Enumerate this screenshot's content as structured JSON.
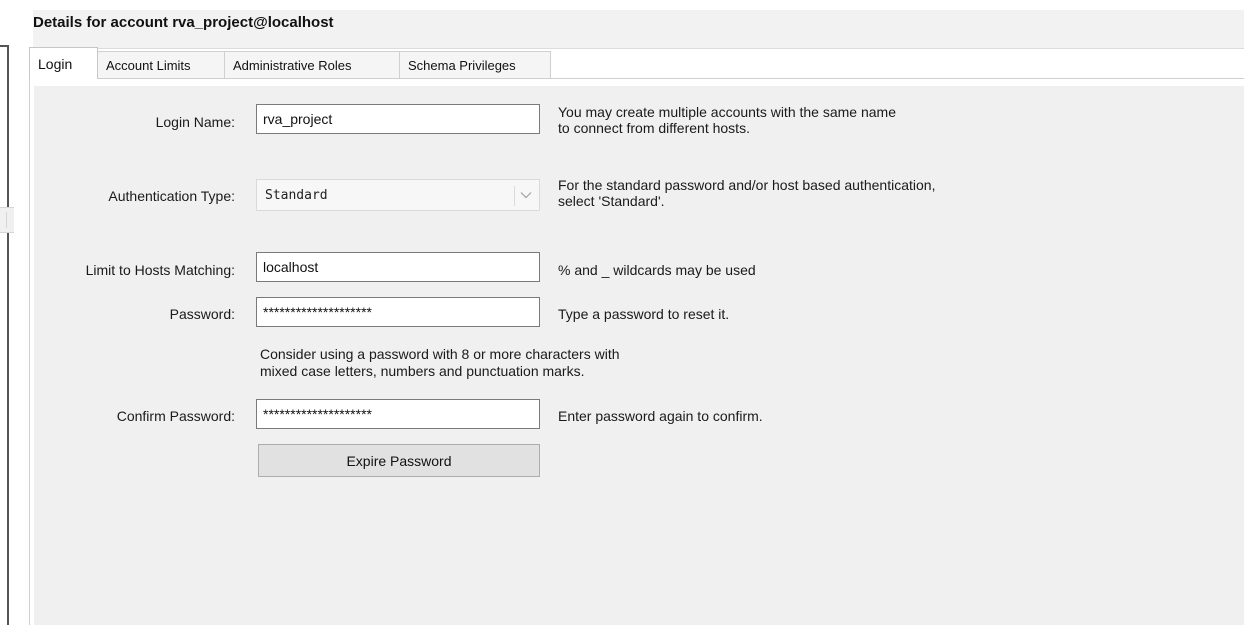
{
  "header": {
    "title": "Details for account rva_project@localhost"
  },
  "tabs": [
    {
      "label": "Login",
      "active": true
    },
    {
      "label": "Account Limits",
      "active": false
    },
    {
      "label": "Administrative Roles",
      "active": false
    },
    {
      "label": "Schema Privileges",
      "active": false
    }
  ],
  "form": {
    "login_name": {
      "label": "Login Name:",
      "value": "rva_project",
      "hint_line1": "You may create multiple accounts with the same name",
      "hint_line2": "to connect from different hosts."
    },
    "auth_type": {
      "label": "Authentication Type:",
      "value": "Standard",
      "hint_line1": "For the standard password and/or host based authentication,",
      "hint_line2": "select 'Standard'."
    },
    "hosts": {
      "label": "Limit to Hosts Matching:",
      "value": "localhost",
      "hint": "% and _ wildcards may be used"
    },
    "password": {
      "label": "Password:",
      "value": "********************",
      "hint": "Type a password to reset it."
    },
    "password_note": {
      "line1": "Consider using a password with 8 or more characters with",
      "line2": "mixed case letters, numbers and punctuation marks."
    },
    "confirm_password": {
      "label": "Confirm Password:",
      "value": "********************",
      "hint": "Enter password again to confirm."
    },
    "expire_button": {
      "label": "Expire Password"
    }
  },
  "icons": {
    "dropdown": "chevron-down-icon"
  },
  "colors": {
    "panel_bg": "#f0f0f0",
    "header_bg": "#f2f2f2",
    "button_bg": "#e1e1e1"
  }
}
